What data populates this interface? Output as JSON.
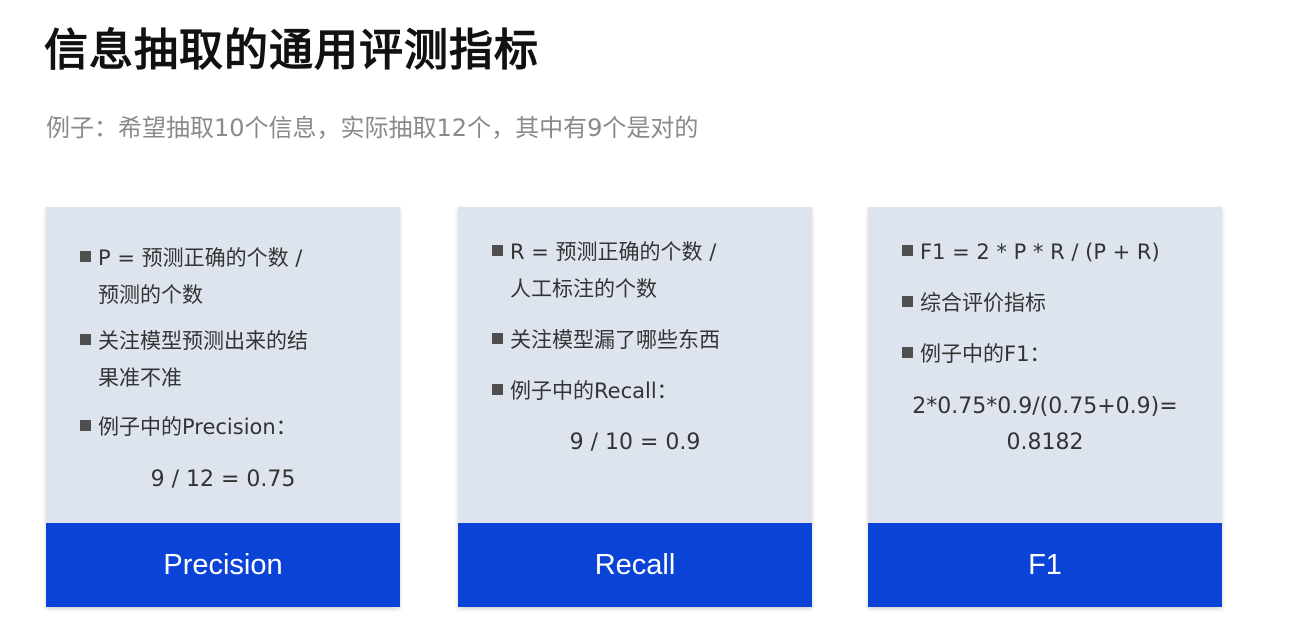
{
  "title": "信息抽取的通用评测指标",
  "subtitle": "例子：希望抽取10个信息，实际抽取12个，其中有9个是对的",
  "cards": [
    {
      "footer": "Precision",
      "items": [
        {
          "line1": "P = 预测正确的个数 /",
          "line2": "预测的个数"
        },
        {
          "line1": "关注模型预测出来的结",
          "line2": "果准不准"
        },
        {
          "line1": "例子中的Precision："
        }
      ],
      "result": [
        "9 / 12 = 0.75"
      ]
    },
    {
      "footer": "Recall",
      "items": [
        {
          "line1": "R = 预测正确的个数 /",
          "line2": "人工标注的个数"
        },
        {
          "line1": "关注模型漏了哪些东西"
        },
        {
          "line1": "例子中的Recall："
        }
      ],
      "result": [
        "9 / 10 = 0.9"
      ]
    },
    {
      "footer": "F1",
      "items": [
        {
          "line1": "F1 = 2 * P * R / (P + R)"
        },
        {
          "line1": "综合评价指标"
        },
        {
          "line1": "例子中的F1："
        }
      ],
      "result": [
        "2*0.75*0.9/(0.75+0.9)=",
        "0.8182"
      ]
    }
  ],
  "colors": {
    "card_body": "#dde4ee",
    "card_footer": "#0b43d6",
    "subtitle": "#8a8a8a"
  }
}
